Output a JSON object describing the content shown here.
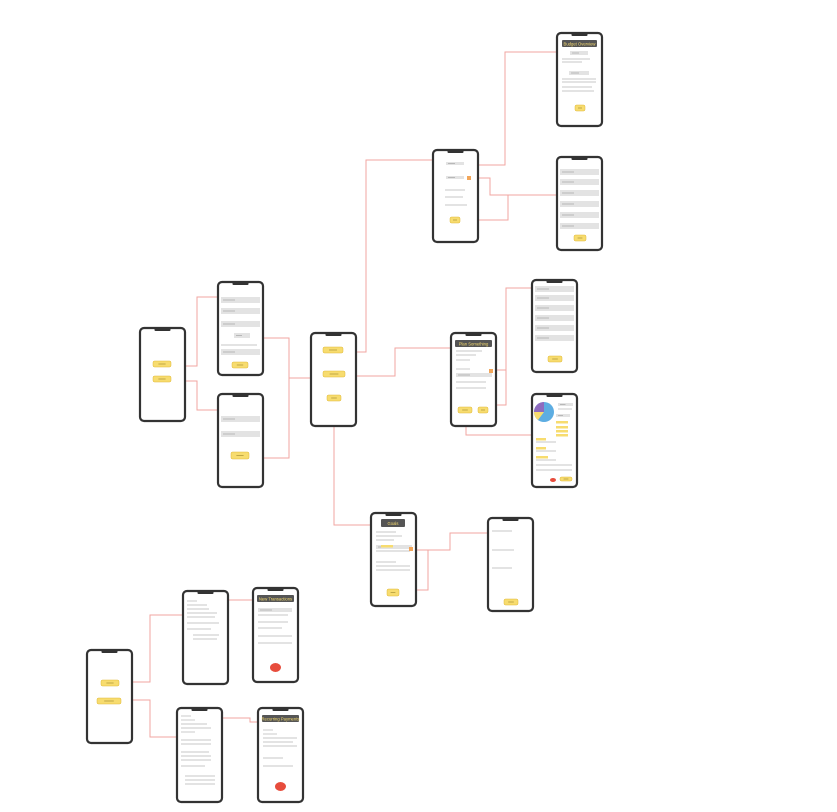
{
  "colors": {
    "connector": "#f2a6a0",
    "phone_frame": "#333333",
    "notch": "#333333",
    "bar": "#e3e3e3",
    "line": "#b5b5b5",
    "accent": "#f7dc6f",
    "accent_border": "#e0b838",
    "header": "#555555",
    "header_text": "#f7dc6f",
    "red_button": "#e74c3c",
    "pie_blue": "#5dade2",
    "pie_purple": "#8e6bbf",
    "pie_yellow": "#f7dc6f",
    "port": "#f2a65a"
  },
  "screens": {
    "title_b": "Budget Overview",
    "title_f": "Plan Something",
    "title_i": "Goals",
    "title_m": "New Transactions",
    "title_o": "Recurring Payments"
  }
}
